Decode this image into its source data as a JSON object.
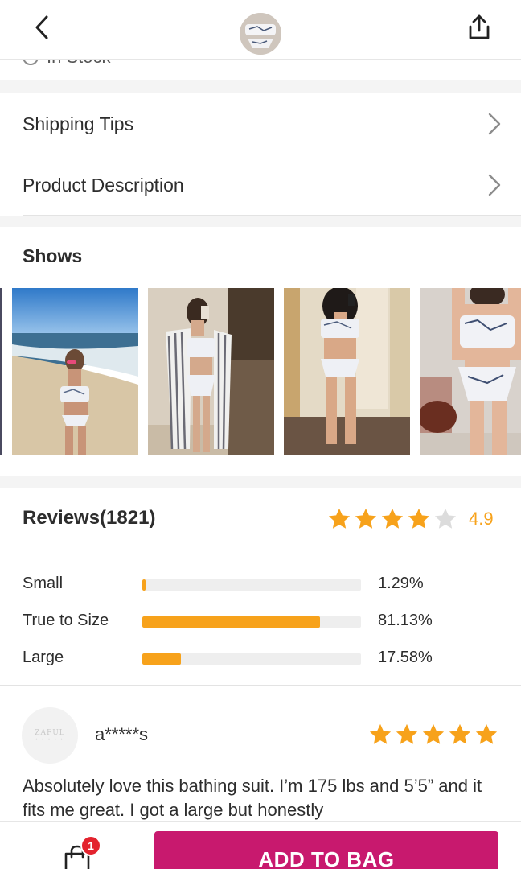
{
  "header": {
    "back_icon": "chevron-left-icon",
    "share_icon": "share-icon"
  },
  "stock": {
    "label": "In Stock"
  },
  "menu": [
    {
      "label": "Shipping Tips",
      "icon": "chevron-right-icon"
    },
    {
      "label": "Product Description",
      "icon": "chevron-right-icon"
    }
  ],
  "shows": {
    "title": "Shows",
    "photos": [
      "beach-photo",
      "mirror-selfie-kimono",
      "mirror-selfie-hallway",
      "studio-photo"
    ]
  },
  "reviews": {
    "title": "Reviews(1821)",
    "rating": "4.9",
    "rating_stars": 4.9,
    "fit": [
      {
        "label": "Small",
        "percent_text": "1.29%",
        "value": 1.29
      },
      {
        "label": "True to Size",
        "percent_text": "81.13%",
        "value": 81.13
      },
      {
        "label": "Large",
        "percent_text": "17.58%",
        "value": 17.58
      }
    ],
    "first": {
      "avatar_text": "ZAFUL",
      "username": "a*****s",
      "stars": 5,
      "text": "Absolutely love this bathing suit. I’m 175 lbs and 5’5” and it fits me great. I got a large but honestly"
    }
  },
  "bottom": {
    "cart_icon": "shopping-bag-icon",
    "cart_count": "1",
    "add_button": "ADD TO BAG"
  },
  "colors": {
    "accent": "#f7a21b",
    "button": "#c8196e",
    "badge": "#e3232e",
    "star_empty": "#dcdcdc"
  }
}
